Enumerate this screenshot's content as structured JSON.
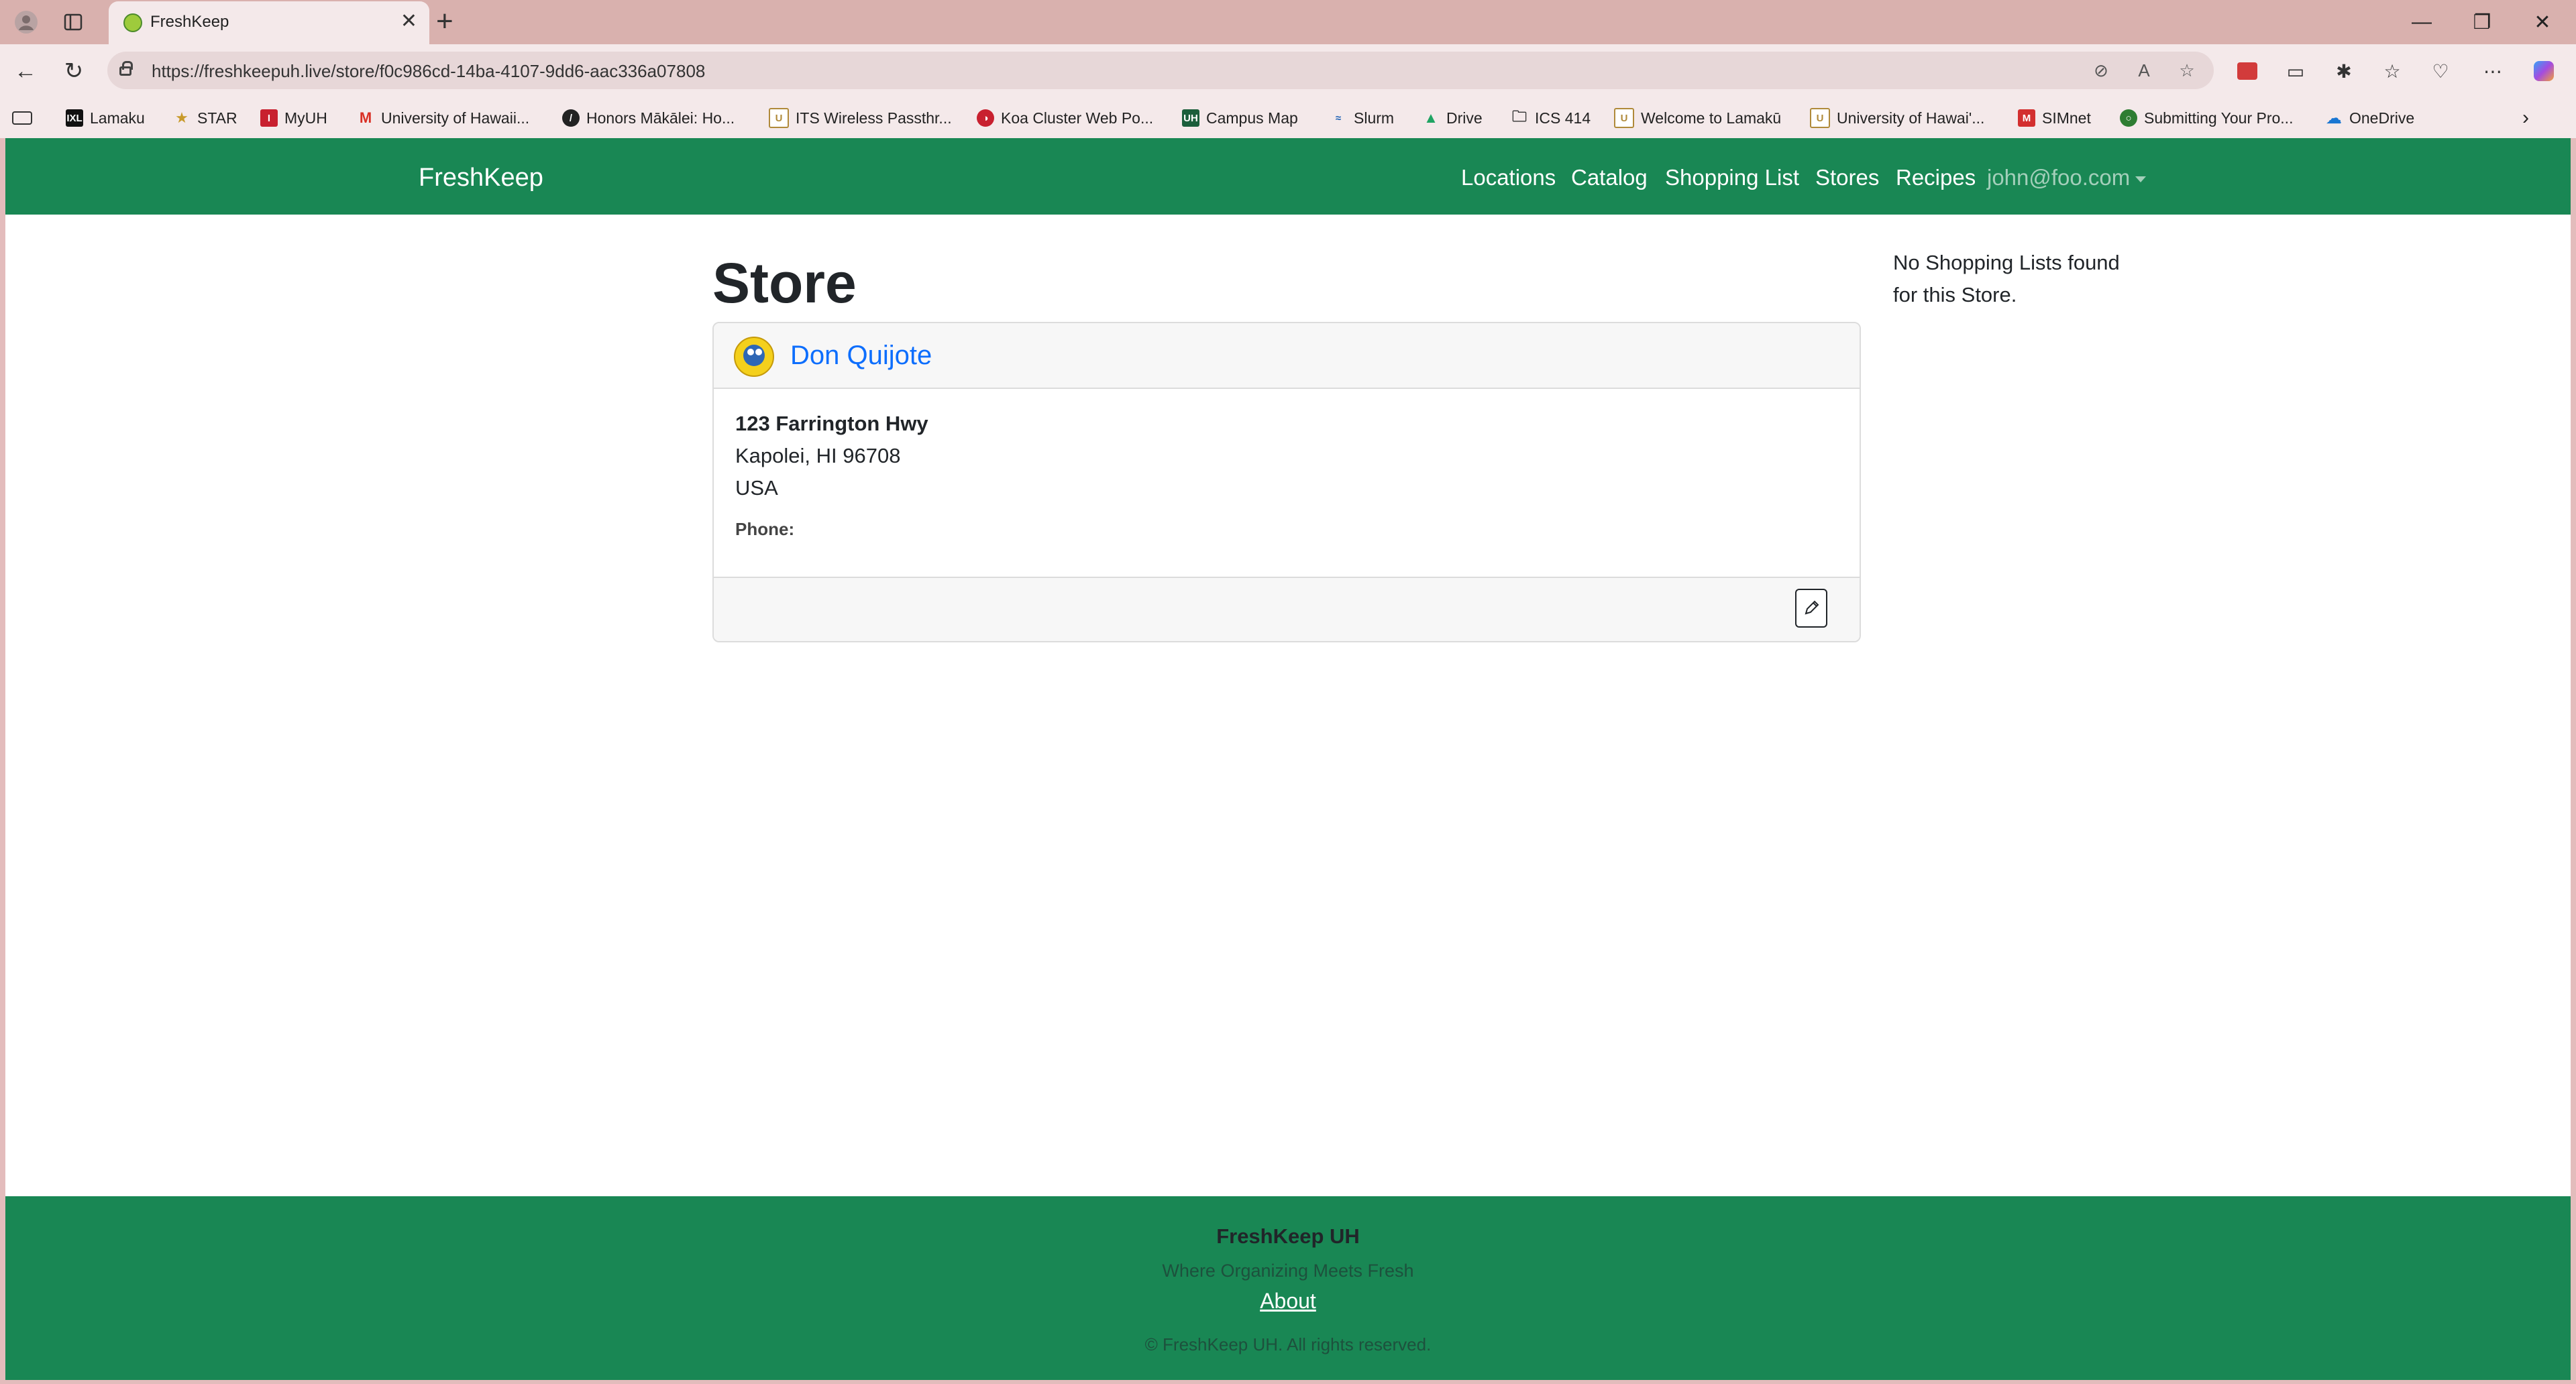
{
  "browser": {
    "tab_title": "FreshKeep",
    "url": "https://freshkeepuh.live/store/f0c986cd-14ba-4107-9dd6-aac336a07808",
    "bookmarks": [
      {
        "label": "Lamaku",
        "icon": "lamaku-icon"
      },
      {
        "label": "STAR",
        "icon": "star-icon"
      },
      {
        "label": "MyUH",
        "icon": "myuh-icon"
      },
      {
        "label": "University of Hawaii...",
        "icon": "gmail-icon"
      },
      {
        "label": "Honors Mākālei: Ho...",
        "icon": "honors-icon"
      },
      {
        "label": "ITS Wireless Passthr...",
        "icon": "uh-icon"
      },
      {
        "label": "Koa Cluster Web Po...",
        "icon": "koa-icon"
      },
      {
        "label": "Campus Map",
        "icon": "uh-icon"
      },
      {
        "label": "Slurm",
        "icon": "slurm-icon"
      },
      {
        "label": "Drive",
        "icon": "drive-icon"
      },
      {
        "label": "ICS 414",
        "icon": "folder-icon"
      },
      {
        "label": "Welcome to Lamakū",
        "icon": "uh-icon"
      },
      {
        "label": "University of Hawai'...",
        "icon": "uh-icon"
      },
      {
        "label": "SIMnet",
        "icon": "simnet-icon"
      },
      {
        "label": "Submitting Your Pro...",
        "icon": "submit-icon"
      },
      {
        "label": "OneDrive",
        "icon": "onedrive-icon"
      }
    ]
  },
  "navbar": {
    "brand": "FreshKeep",
    "links": [
      "Locations",
      "Catalog",
      "Shopping List",
      "Stores",
      "Recipes"
    ],
    "user": "john@foo.com"
  },
  "page": {
    "title": "Store",
    "store": {
      "name": "Don Quijote",
      "address_line1": "123 Farrington Hwy",
      "address_line2": "Kapolei, HI 96708",
      "country": "USA",
      "phone_label": "Phone:"
    },
    "side_note": "No Shopping Lists found for this Store."
  },
  "footer": {
    "title": "FreshKeep UH",
    "tagline": "Where Organizing Meets Fresh",
    "about": "About",
    "copyright": "© FreshKeep UH. All rights reserved."
  },
  "colors": {
    "brand_green": "#198754",
    "link_blue": "#0d6efd",
    "chrome_bg": "#d9b1ae"
  }
}
